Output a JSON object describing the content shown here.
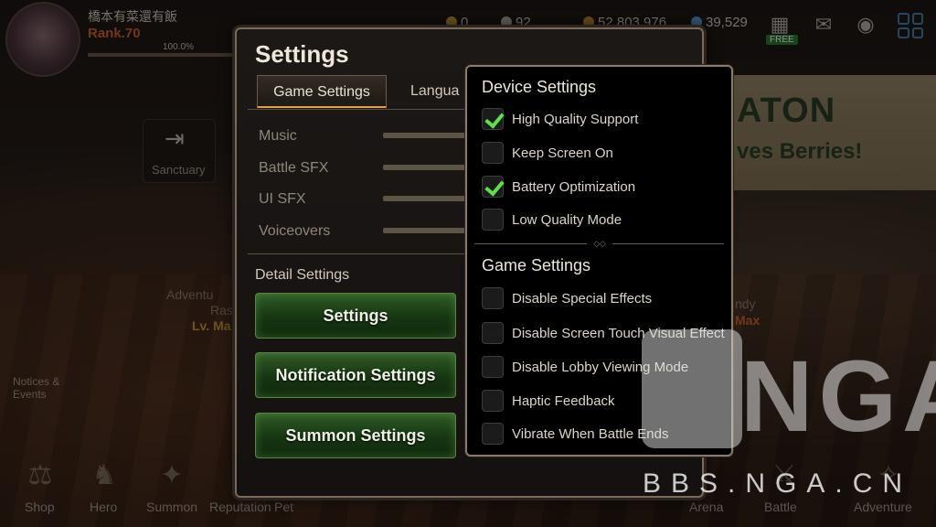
{
  "player": {
    "name": "橋本有菜還有飯",
    "rank": "Rank.70",
    "exp_percent": "100.0%"
  },
  "resources": [
    {
      "value": "0",
      "color": "#c49a3a"
    },
    {
      "value": "92",
      "color": "#b7b0a4"
    },
    {
      "value": "52,803,976",
      "color": "#c98a2e"
    },
    {
      "value": "39,529",
      "color": "#5c9bd6"
    }
  ],
  "top_bar": {
    "free_label": "FREE"
  },
  "background": {
    "sanctuary_label": "Sanctuary",
    "banner_title": "ATON",
    "banner_subtitle": "ves Berries!",
    "adventure_text": "Adventu",
    "ras_text": "Ras",
    "lv_text": "Lv. Ma",
    "ndy_text": "ndy",
    "max_text": "Max",
    "notices_label": "Notices & Events"
  },
  "bottom_nav": [
    {
      "label": "Shop"
    },
    {
      "label": "Hero"
    },
    {
      "label": "Summon"
    },
    {
      "label": "Reputation"
    },
    {
      "label": "Pet"
    },
    {
      "label": "Arena"
    },
    {
      "label": "Battle"
    },
    {
      "label": "Adventure"
    }
  ],
  "settings": {
    "title": "Settings",
    "tabs": [
      {
        "label": "Game Settings"
      },
      {
        "label": "Langua"
      }
    ],
    "volume_rows": [
      {
        "label": "Music"
      },
      {
        "label": "Battle SFX"
      },
      {
        "label": "UI SFX"
      },
      {
        "label": "Voiceovers"
      }
    ],
    "detail_label": "Detail Settings",
    "buttons": [
      {
        "label": "Settings"
      },
      {
        "label": "Notification Settings"
      },
      {
        "label": "Summon Settings"
      }
    ]
  },
  "popup": {
    "device_heading": "Device Settings",
    "device_options": [
      {
        "label": "High Quality Support",
        "checked": true
      },
      {
        "label": "Keep Screen On",
        "checked": false
      },
      {
        "label": "Battery Optimization",
        "checked": true
      },
      {
        "label": "Low Quality Mode",
        "checked": false
      }
    ],
    "game_heading": "Game Settings",
    "game_options": [
      {
        "label": "Disable Special Effects",
        "checked": false
      },
      {
        "label": "Disable Screen Touch Visual Effect",
        "checked": false
      },
      {
        "label": "Disable Lobby Viewing Mode",
        "checked": false
      },
      {
        "label": "Haptic Feedback",
        "checked": false
      },
      {
        "label": "Vibrate When Battle Ends",
        "checked": false
      }
    ]
  },
  "watermark": {
    "big": "NGA",
    "url": "BBS.NGA.CN"
  }
}
